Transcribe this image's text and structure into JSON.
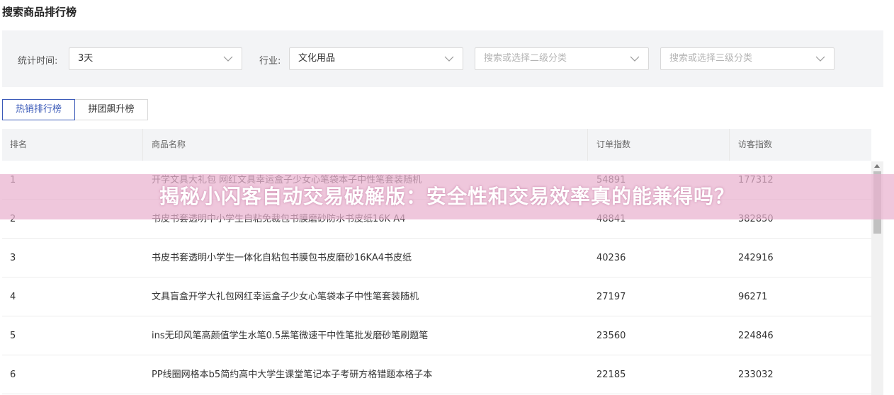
{
  "page": {
    "title": "搜索商品排行榜"
  },
  "filters": {
    "time_label": "统计时间:",
    "time_value": "3天",
    "industry_label": "行业:",
    "industry_value": "文化用品",
    "level2_placeholder": "搜索或选择二级分类",
    "level3_placeholder": "搜索或选择三级分类"
  },
  "tabs": [
    {
      "label": "热销排行榜",
      "active": true
    },
    {
      "label": "拼团飙升榜",
      "active": false
    }
  ],
  "table": {
    "columns": [
      "排名",
      "商品名称",
      "订单指数",
      "访客指数"
    ],
    "rows": [
      {
        "rank": "1",
        "name": "开学文具大礼包 网红文具幸运盒子少女心笔袋本子中性笔套装随机",
        "orders": "54891",
        "visitors": "177312"
      },
      {
        "rank": "2",
        "name": "书皮书套透明中小学生自粘免裁包书膜磨砂防水书皮纸16K A4",
        "orders": "48841",
        "visitors": "382850"
      },
      {
        "rank": "3",
        "name": "书皮书套透明小学生一体化自粘包书膜包书皮磨砂16KA4书皮纸",
        "orders": "40236",
        "visitors": "242916"
      },
      {
        "rank": "4",
        "name": "文具盲盒开学大礼包网红幸运盒子少女心笔袋本子中性笔套装随机",
        "orders": "27197",
        "visitors": "96271"
      },
      {
        "rank": "5",
        "name": "ins无印风笔高颜值学生水笔0.5黑笔微速干中性笔批发磨砂笔刷题笔",
        "orders": "23560",
        "visitors": "224846"
      },
      {
        "rank": "6",
        "name": "PP线圈网格本b5简约高中大学生课堂笔记本子考研方格错题本格子本",
        "orders": "22185",
        "visitors": "233032"
      }
    ]
  },
  "banner": {
    "text": "揭秘小闪客自动交易破解版：安全性和交易效率真的能兼得吗？"
  },
  "colors": {
    "accent": "#3b5ab8",
    "banner": "#e9b2ce",
    "panel": "#f3f4f6"
  }
}
